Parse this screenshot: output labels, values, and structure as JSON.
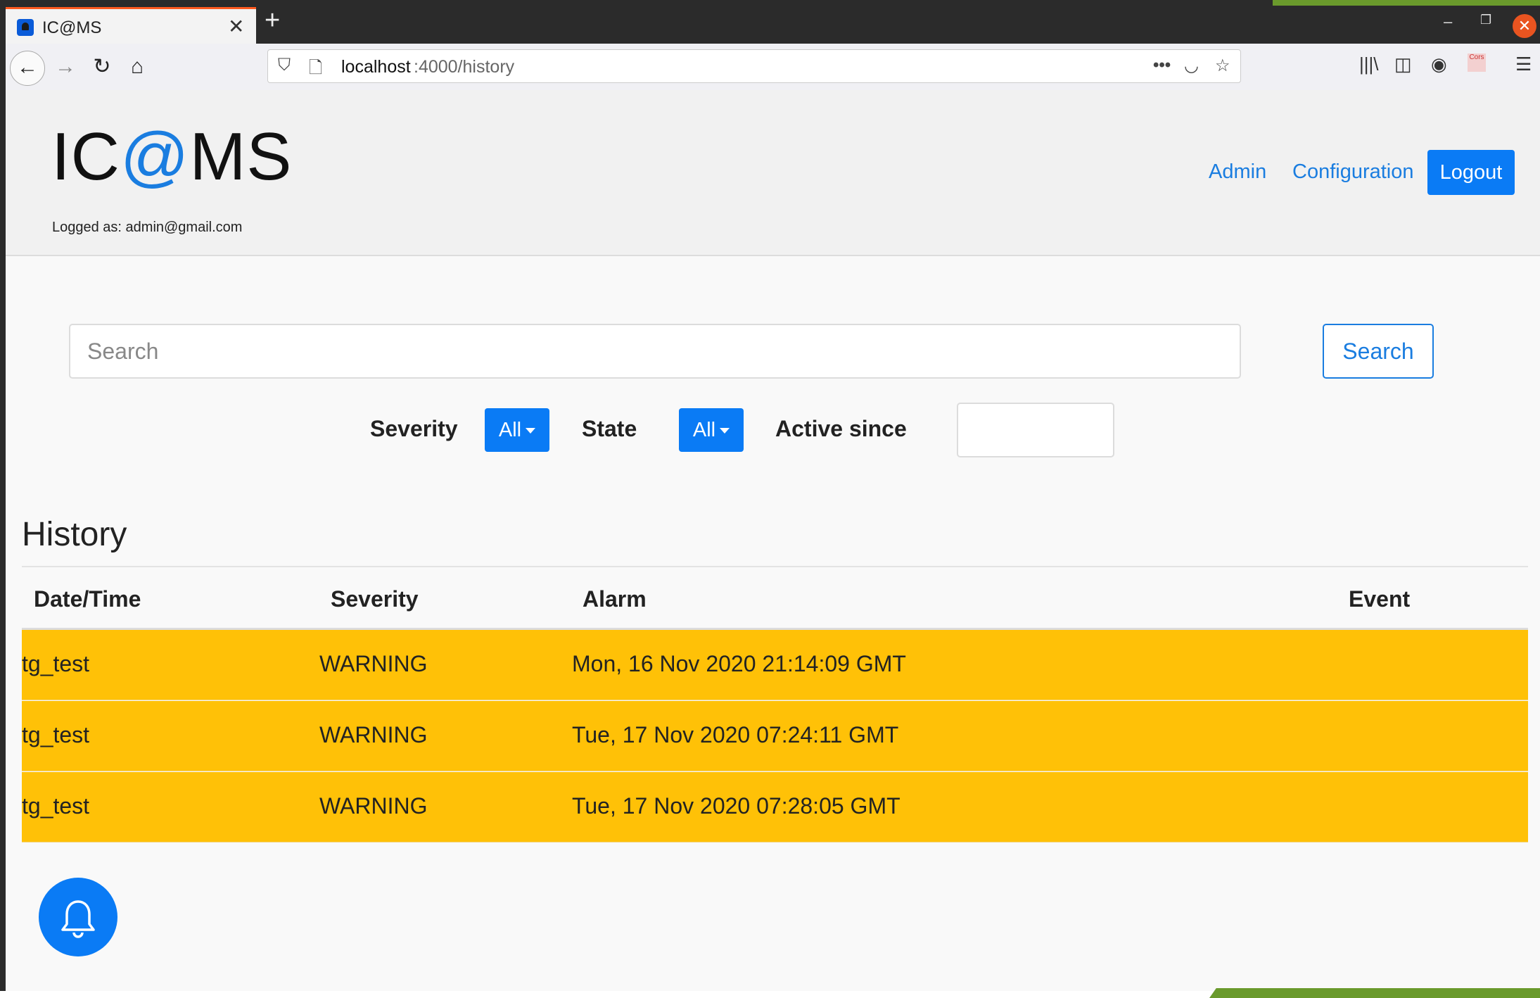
{
  "browser": {
    "tab_title": "IC@MS",
    "url_host": "localhost",
    "url_path": ":4000/history"
  },
  "app": {
    "logo_prefix": "IC",
    "logo_at": "@",
    "logo_suffix": "MS",
    "logged_as": "Logged as: admin@gmail.com",
    "nav": {
      "admin": "Admin",
      "configuration": "Configuration",
      "logout": "Logout"
    }
  },
  "search": {
    "placeholder": "Search",
    "value": "",
    "button_label": "Search"
  },
  "filters": {
    "severity_label": "Severity",
    "severity_value": "All",
    "state_label": "State",
    "state_value": "All",
    "active_since_label": "Active since",
    "active_since_value": ""
  },
  "history": {
    "title": "History",
    "columns": [
      "Date/Time",
      "Severity",
      "Alarm",
      "Event"
    ],
    "rows": [
      {
        "col1": "tg_test",
        "col2": "WARNING",
        "col3": "Mon, 16 Nov 2020 21:14:09 GMT",
        "col4": ""
      },
      {
        "col1": "tg_test",
        "col2": "WARNING",
        "col3": "Tue, 17 Nov 2020 07:24:11 GMT",
        "col4": ""
      },
      {
        "col1": "tg_test",
        "col2": "WARNING",
        "col3": "Tue, 17 Nov 2020 07:28:05 GMT",
        "col4": ""
      }
    ],
    "row_color": "#ffc107"
  },
  "colors": {
    "primary": "#0a7bf5",
    "warning": "#ffc107",
    "link": "#1a7de0"
  },
  "icons": {
    "tab": "app-favicon-icon",
    "close": "close-icon",
    "new_tab": "plus-icon",
    "back": "back-arrow-icon",
    "forward": "forward-arrow-icon",
    "reload": "reload-icon",
    "home": "home-icon",
    "shield": "shield-icon",
    "page": "page-icon",
    "more": "more-icon",
    "pocket": "pocket-icon",
    "bookmark": "star-icon",
    "library": "library-icon",
    "sidebar": "sidebar-icon",
    "account": "account-icon",
    "cors": "cors-extension-icon",
    "menu": "hamburger-menu-icon",
    "notifications": "bell-icon"
  }
}
